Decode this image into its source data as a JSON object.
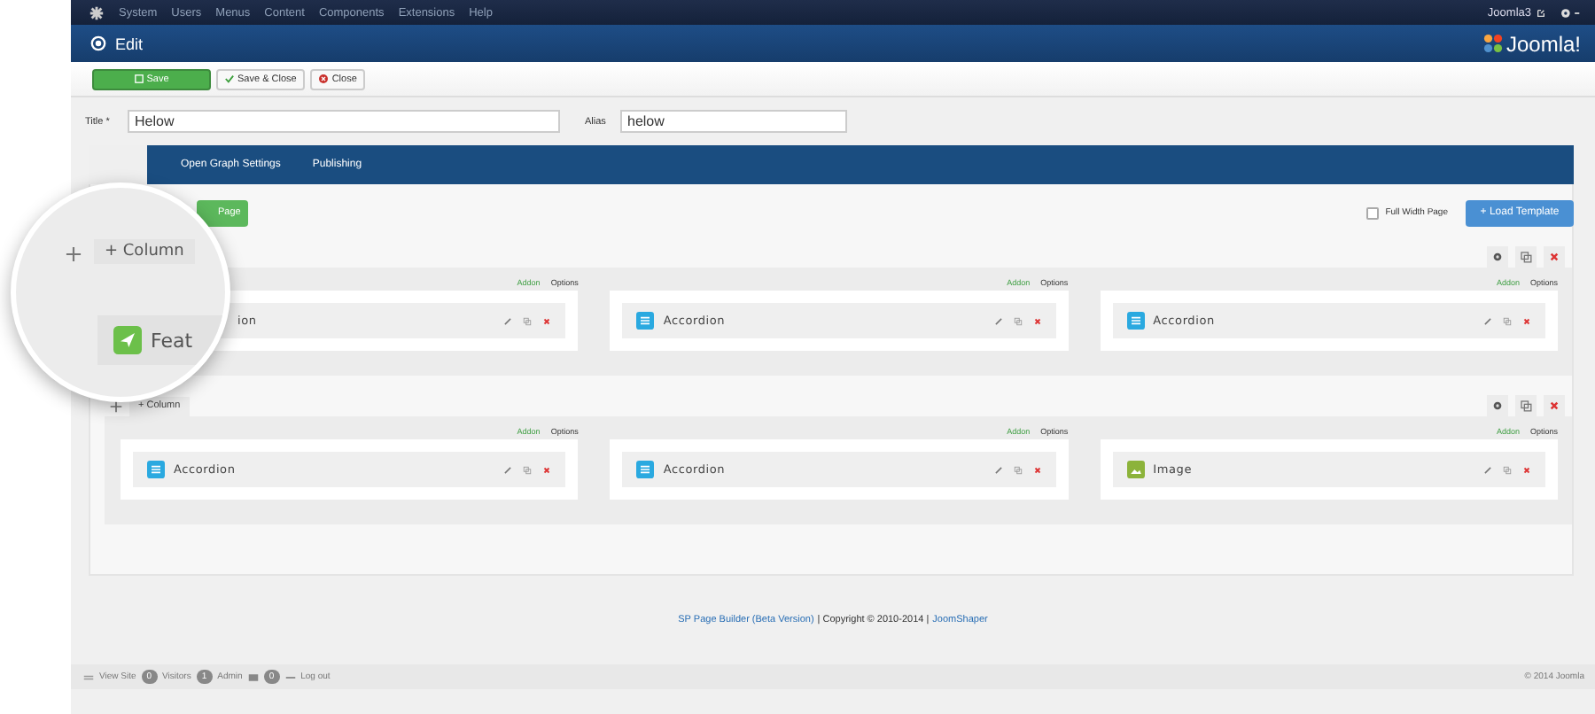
{
  "top_menu": {
    "items": [
      "System",
      "Users",
      "Menus",
      "Content",
      "Components",
      "Extensions",
      "Help"
    ],
    "site_link": "Joomla3"
  },
  "header": {
    "title": "Edit",
    "logo": "Joomla!"
  },
  "toolbar": {
    "buttons": [
      {
        "label": "Save",
        "kind": "primary"
      },
      {
        "label": "Save & Close",
        "kind": "check"
      },
      {
        "label": "Close",
        "kind": "close"
      }
    ]
  },
  "form": {
    "title_label": "Title *",
    "title_value": "Helow",
    "alias_label": "Alias",
    "alias_value": "helow"
  },
  "tabs": [
    {
      "label": "Open Graph Settings",
      "selected": false
    },
    {
      "label": "Publishing",
      "selected": false
    }
  ],
  "builder": {
    "new_page_button": "Page",
    "full_width": {
      "label": "Full Width Page",
      "checked": false
    },
    "load_template": "+ Load Template",
    "rows": [
      {
        "columns": [
          {
            "addon_link": "Addon",
            "options_link": "Options",
            "addons": [
              {
                "title": "ion",
                "kind": "hidden"
              }
            ]
          },
          {
            "addon_link": "Addon",
            "options_link": "Options",
            "addons": [
              {
                "title": "Accordion",
                "kind": "accordion"
              }
            ]
          },
          {
            "addon_link": "Addon",
            "options_link": "Options",
            "addons": [
              {
                "title": "Accordion",
                "kind": "accordion"
              }
            ]
          }
        ]
      },
      {
        "column_button": "+ Column",
        "columns": [
          {
            "addon_link": "Addon",
            "options_link": "Options",
            "addons": [
              {
                "title": "Accordion",
                "kind": "accordion"
              }
            ]
          },
          {
            "addon_link": "Addon",
            "options_link": "Options",
            "addons": [
              {
                "title": "Accordion",
                "kind": "accordion"
              }
            ]
          },
          {
            "addon_link": "Addon",
            "options_link": "Options",
            "addons": [
              {
                "title": "Image",
                "kind": "image"
              }
            ]
          }
        ]
      }
    ]
  },
  "magnifier": {
    "column_button": "+ Column",
    "addon_title": "Feat"
  },
  "footer": {
    "credit_link": "SP Page Builder (Beta Version)",
    "copyright": "| Copyright © 2010-2014 |",
    "author_link": "JoomShaper"
  },
  "status_bar": {
    "view_site": "View Site",
    "visitors_count": "0",
    "visitors": "Visitors",
    "admin_count": "1",
    "admin": "Admin",
    "messages_count": "0",
    "logout": "Log out",
    "copyright": "© 2014 Joomla"
  }
}
